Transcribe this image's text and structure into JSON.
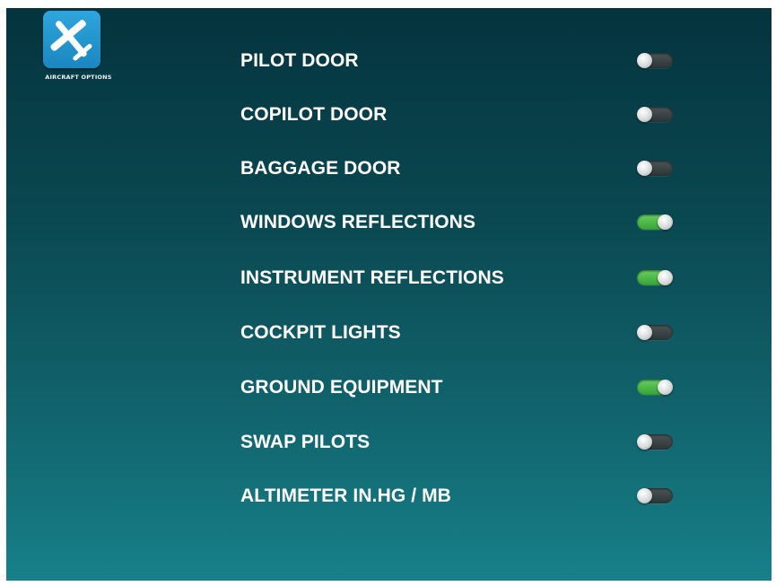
{
  "app_icon": {
    "icon": "airplane-icon",
    "caption": "AIRCRAFT OPTIONS",
    "tile_color": "#2a9fd8"
  },
  "colors": {
    "background_top": "#04343e",
    "background_bottom": "#178089",
    "toggle_on": "#4cbf48",
    "toggle_off": "#3a4446",
    "label": "#ffffff"
  },
  "options": [
    {
      "label": "PILOT DOOR",
      "state": "off"
    },
    {
      "label": "COPILOT DOOR",
      "state": "off"
    },
    {
      "label": "BAGGAGE DOOR",
      "state": "off"
    },
    {
      "label": "WINDOWS REFLECTIONS",
      "state": "on"
    },
    {
      "label": "INSTRUMENT REFLECTIONS",
      "state": "on"
    },
    {
      "label": "COCKPIT LIGHTS",
      "state": "off"
    },
    {
      "label": "GROUND EQUIPMENT",
      "state": "on"
    },
    {
      "label": "SWAP PILOTS",
      "state": "off"
    },
    {
      "label": "ALTIMETER IN.HG / MB",
      "state": "off"
    }
  ]
}
